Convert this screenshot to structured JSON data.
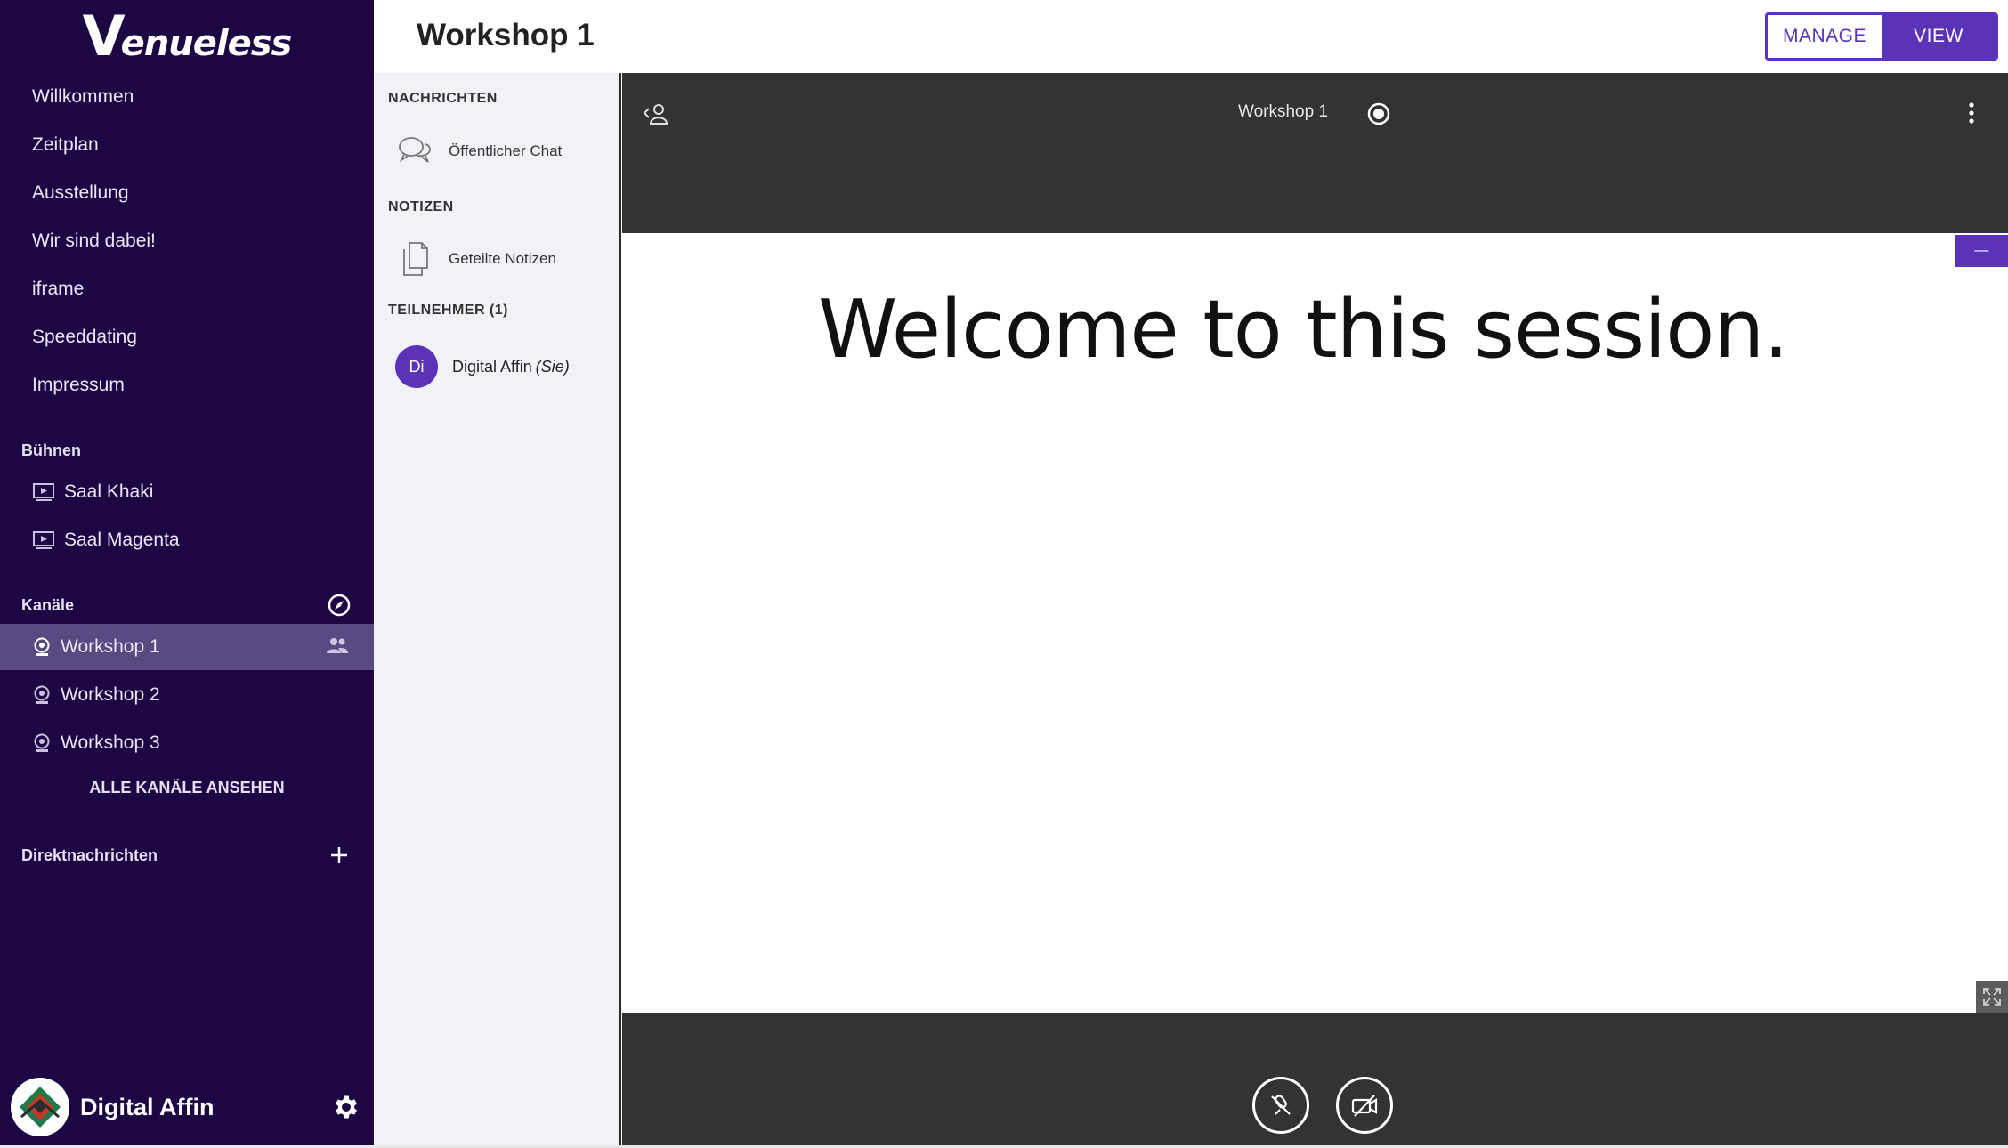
{
  "brand": {
    "logo_text": "enueless",
    "logo_initial": "V"
  },
  "sidebar": {
    "nav": [
      "Willkommen",
      "Zeitplan",
      "Ausstellung",
      "Wir sind dabei!",
      "iframe",
      "Speeddating",
      "Impressum"
    ],
    "stages_head": "Bühnen",
    "stages": [
      "Saal Khaki",
      "Saal Magenta"
    ],
    "channels_head": "Kanäle",
    "channels": [
      "Workshop 1",
      "Workshop 2",
      "Workshop 3"
    ],
    "active_channel": "Workshop 1",
    "all_channels_label": "ALLE KANÄLE ANSEHEN",
    "dm_head": "Direktnachrichten",
    "user_name": "Digital Affin"
  },
  "header": {
    "title": "Workshop 1",
    "manage_label": "MANAGE",
    "view_label": "VIEW"
  },
  "panel": {
    "messages_head": "NACHRICHTEN",
    "public_chat": "Öffentlicher Chat",
    "notes_head": "NOTIZEN",
    "shared_notes": "Geteilte Notizen",
    "participants_head": "TEILNEHMER (1)",
    "participant": {
      "initials": "Di",
      "name": "Digital Affin",
      "you": "(Sie)"
    }
  },
  "stage": {
    "room_name": "Workshop 1",
    "slide_text": "Welcome to this session.",
    "minimize_label": "—"
  },
  "colors": {
    "sidebar_bg": "#1c0644",
    "accent": "#5a33b8",
    "stage_bg": "#333333",
    "panel_bg": "#f0f2f7"
  }
}
